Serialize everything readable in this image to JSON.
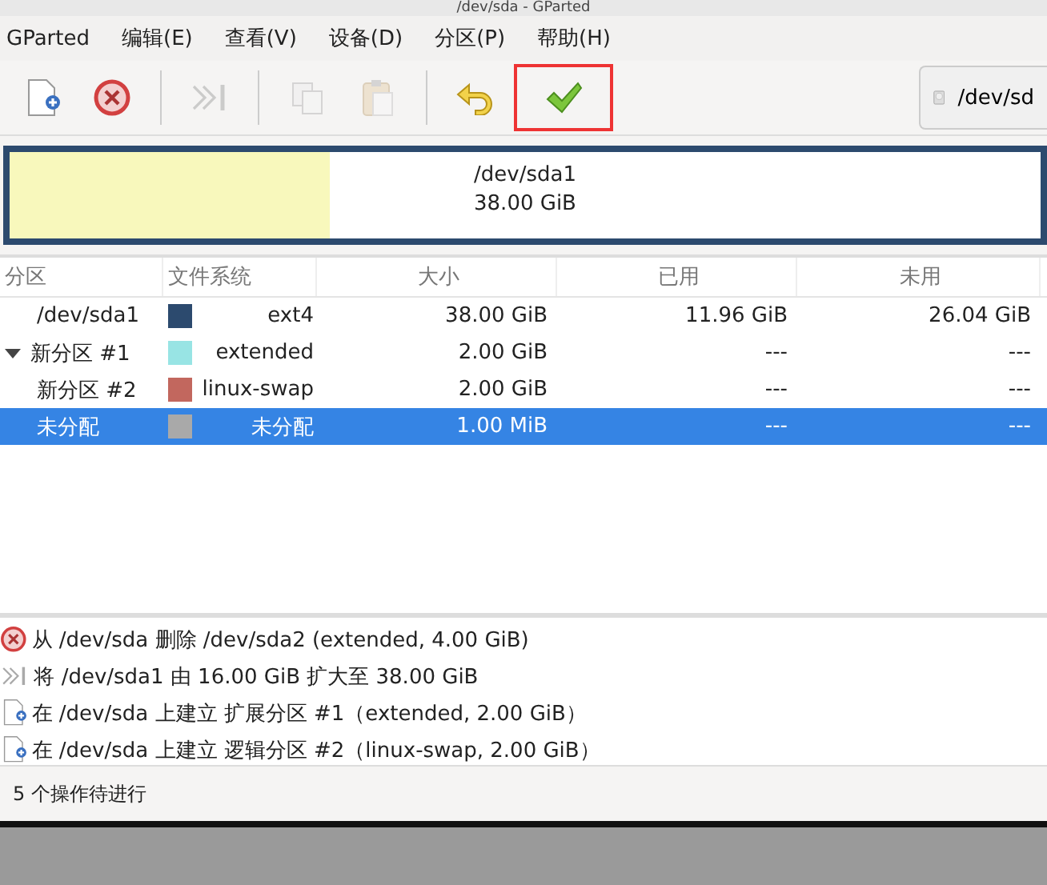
{
  "window": {
    "title": "/dev/sda - GParted"
  },
  "menu": [
    "GParted",
    "编辑(E)",
    "查看(V)",
    "设备(D)",
    "分区(P)",
    "帮助(H)"
  ],
  "toolbar": [
    {
      "kind": "new",
      "disabled": false,
      "highlighted": false
    },
    {
      "kind": "delete",
      "disabled": false,
      "highlighted": false
    },
    {
      "kind": "separator"
    },
    {
      "kind": "resize",
      "disabled": true,
      "highlighted": false
    },
    {
      "kind": "separator"
    },
    {
      "kind": "copy",
      "disabled": true,
      "highlighted": false
    },
    {
      "kind": "paste",
      "disabled": true,
      "highlighted": false
    },
    {
      "kind": "separator"
    },
    {
      "kind": "undo",
      "disabled": false,
      "highlighted": false
    },
    {
      "kind": "apply",
      "disabled": false,
      "highlighted": true
    }
  ],
  "device": {
    "label": "/dev/sd"
  },
  "disk_map": {
    "name": "/dev/sda1",
    "size": "38.00 GiB",
    "level": 0.31
  },
  "table": {
    "columns": [
      "分区",
      "文件系统",
      "大小",
      "已用",
      "未用"
    ],
    "rows": [
      {
        "partition": "/dev/sda1",
        "color": "#2c4a6e",
        "filesystem": "ext4",
        "size": "38.00 GiB",
        "used": "11.96 GiB",
        "unused": "26.04 GiB",
        "selected": false
      },
      {
        "partition": "新分区 #1",
        "color": "#98e4e4",
        "filesystem": "extended",
        "size": "2.00 GiB",
        "used": "---",
        "unused": "---",
        "selected": false,
        "expanded": true,
        "children": [
          {
            "partition": "新分区 #2",
            "color": "#c2675e",
            "filesystem": "linux-swap",
            "size": "2.00 GiB",
            "used": "---",
            "unused": "---",
            "selected": false
          },
          {
            "partition": "未分配",
            "color": "#a9a9a9",
            "filesystem": "未分配",
            "size": "1.00 MiB",
            "used": "---",
            "unused": "---",
            "selected": true
          }
        ]
      }
    ]
  },
  "operations": [
    {
      "kind": "delete",
      "text": "从 /dev/sda 删除 /dev/sda2 (extended, 4.00 GiB)"
    },
    {
      "kind": "resize",
      "text": "将 /dev/sda1 由 16.00 GiB 扩大至 38.00 GiB"
    },
    {
      "kind": "new",
      "text": "在 /dev/sda 上建立 扩展分区 #1（extended, 2.00 GiB）"
    },
    {
      "kind": "new",
      "text": "在 /dev/sda 上建立 逻辑分区 #2（linux-swap, 2.00 GiB）"
    }
  ],
  "status_bar": "5 个操作待进行"
}
